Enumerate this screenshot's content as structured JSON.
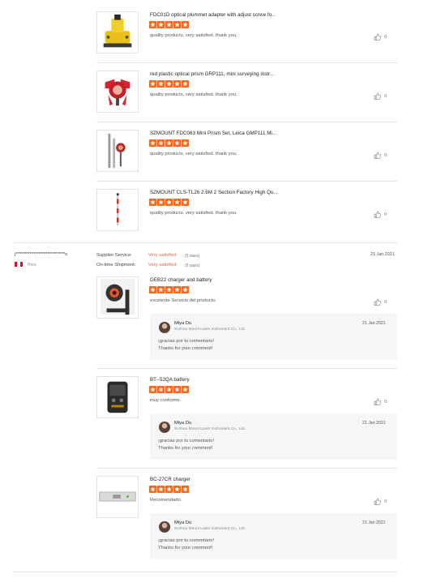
{
  "products_top": [
    {
      "title": "FDC01D optical plummet adapter with adjust screw fo...",
      "rating": 5,
      "comment": "quality products, very satisfied. thank you.",
      "likes": "0",
      "icon": "yellow-plummet-adapter"
    },
    {
      "title": "red plastic optical prism GRP111, mini surveying instr...",
      "rating": 5,
      "comment": "quality products, very satisfied. thank you.",
      "likes": "0",
      "icon": "red-prism"
    },
    {
      "title": "SZMOUNT FDC063 Mini Prism Set, Leica GMP111 Mi...",
      "rating": 5,
      "comment": "quality products, very satisfied. thank you.",
      "likes": "0",
      "icon": "mini-prism-set"
    },
    {
      "title": "SZMOUNT CLS-TL26 2.6M 2 Section Factory High Qu...",
      "rating": 5,
      "comment": "quality products, very satisfied. thank you.",
      "likes": "0",
      "icon": "prism-pole"
    }
  ],
  "review": {
    "reviewer": "j****************************s",
    "country": "Peru",
    "supplier_label": "Supplier Service:",
    "supplier_value": "Very satisfied",
    "supplier_note": "(5 stars)",
    "shipment_label": "On-time Shipment:",
    "shipment_value": "Very satisfied",
    "shipment_note": "(5 stars)",
    "date": "21 Jan 2021",
    "items": [
      {
        "title": "GEB22 charger and battery",
        "rating": 5,
        "comment": "excelente Servicio  del producto.",
        "likes": "0",
        "icon": "prism-bracket",
        "reply": {
          "name": "Miya Du",
          "company": "Suzhou Mount Laser Instrument Co., Ltd.",
          "date": "21 Jan 2021",
          "line1": "¡gracias por tu comentario!",
          "line2": "Thanks for your comment!"
        }
      },
      {
        "title": "BT--52QA battery",
        "rating": 5,
        "comment": "muy conforme.",
        "likes": "0",
        "icon": "battery",
        "reply": {
          "name": "Miya Du",
          "company": "Suzhou Mount Laser Instrument Co., Ltd.",
          "date": "21 Jan 2021",
          "line1": "¡gracias por tu comentario!",
          "line2": "Thanks for your comment!"
        }
      },
      {
        "title": "BC-27CR charger",
        "rating": 5,
        "comment": "Recomendado.",
        "likes": "0",
        "icon": "charger",
        "reply": {
          "name": "Miya Du",
          "company": "Suzhou Mount Laser Instrument Co., Ltd.",
          "date": "21 Jan 2021",
          "line1": "¡gracias por tu comentario!",
          "line2": "Thanks for your comment!"
        }
      }
    ]
  },
  "colors": {
    "star": "#f26a21",
    "accent": "#e8673e",
    "divider": "#e5e5e5",
    "reply_bg": "#f5f6f7",
    "flag_red": "#d91023"
  }
}
